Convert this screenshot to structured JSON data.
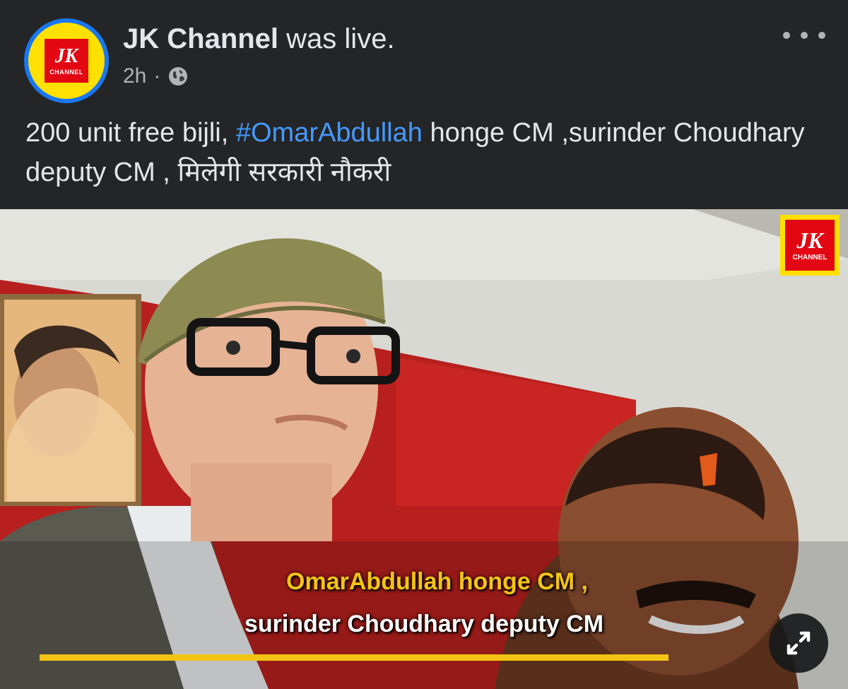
{
  "post": {
    "author": "JK Channel",
    "status": "was live.",
    "time": "2h",
    "separator": "·",
    "text_before_hashtag": "200 unit free bijli, ",
    "hashtag": "#OmarAbdullah",
    "text_after_hashtag": " honge CM ,surinder Choudhary deputy CM , मिलेगी सरकारी नौकरी"
  },
  "avatar": {
    "logo_main": "JK",
    "logo_sub": "CHANNEL"
  },
  "video": {
    "watermark_main": "JK",
    "watermark_sub": "CHANNEL",
    "caption_line1": "OmarAbdullah honge CM ,",
    "caption_line2": "surinder Choudhary deputy CM"
  },
  "icons": {
    "privacy": "globe-icon",
    "more": "more-dots-icon",
    "expand": "expand-icon"
  },
  "colors": {
    "background": "#242526",
    "text": "#e4e6eb",
    "secondary_text": "#b0b3b8",
    "hashtag": "#4599ff",
    "caption_yellow": "#f4c414",
    "brand_red": "#e30613",
    "brand_yellow": "#ffe000",
    "avatar_ring": "#1877f2"
  }
}
